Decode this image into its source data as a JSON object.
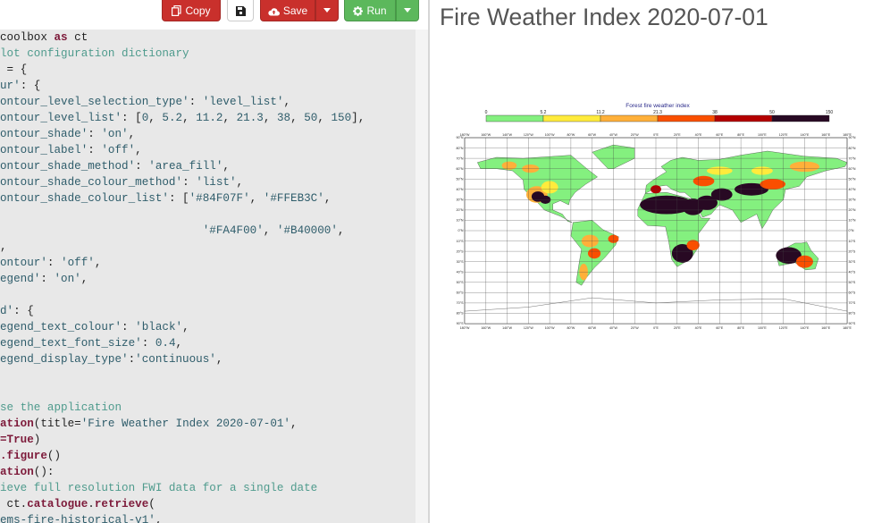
{
  "toolbar": {
    "copy_label": "Copy",
    "save_label": "Save",
    "run_label": "Run"
  },
  "code_lines": [
    [
      [
        "t",
        "coolbox "
      ],
      [
        "k",
        "as"
      ],
      [
        "t",
        " ct"
      ]
    ],
    [
      [
        "c",
        "lot configuration dictionary"
      ]
    ],
    [
      [
        "t",
        " = {"
      ]
    ],
    [
      [
        "s",
        "ur'"
      ],
      [
        "t",
        ": {"
      ]
    ],
    [
      [
        "s",
        "ontour_level_selection_type'"
      ],
      [
        "t",
        ": "
      ],
      [
        "s",
        "'level_list'"
      ],
      [
        "t",
        ","
      ]
    ],
    [
      [
        "s",
        "ontour_level_list'"
      ],
      [
        "t",
        ": ["
      ],
      [
        "n",
        "0"
      ],
      [
        "t",
        ", "
      ],
      [
        "n",
        "5.2"
      ],
      [
        "t",
        ", "
      ],
      [
        "n",
        "11.2"
      ],
      [
        "t",
        ", "
      ],
      [
        "n",
        "21.3"
      ],
      [
        "t",
        ", "
      ],
      [
        "n",
        "38"
      ],
      [
        "t",
        ", "
      ],
      [
        "n",
        "50"
      ],
      [
        "t",
        ", "
      ],
      [
        "n",
        "150"
      ],
      [
        "t",
        "],"
      ]
    ],
    [
      [
        "s",
        "ontour_shade'"
      ],
      [
        "t",
        ": "
      ],
      [
        "s",
        "'on'"
      ],
      [
        "t",
        ","
      ]
    ],
    [
      [
        "s",
        "ontour_label'"
      ],
      [
        "t",
        ": "
      ],
      [
        "s",
        "'off'"
      ],
      [
        "t",
        ","
      ]
    ],
    [
      [
        "s",
        "ontour_shade_method'"
      ],
      [
        "t",
        ": "
      ],
      [
        "s",
        "'area_fill'"
      ],
      [
        "t",
        ","
      ]
    ],
    [
      [
        "s",
        "ontour_shade_colour_method'"
      ],
      [
        "t",
        ": "
      ],
      [
        "s",
        "'list'"
      ],
      [
        "t",
        ","
      ]
    ],
    [
      [
        "s",
        "ontour_shade_colour_list'"
      ],
      [
        "t",
        ": ["
      ],
      [
        "s",
        "'#84F07F'"
      ],
      [
        "t",
        ", "
      ],
      [
        "s",
        "'#FFEB3C'"
      ],
      [
        "t",
        ","
      ]
    ],
    [
      [
        "t",
        ""
      ]
    ],
    [
      [
        "t",
        "                              "
      ],
      [
        "s",
        "'#FA4F00'"
      ],
      [
        "t",
        ", "
      ],
      [
        "s",
        "'#B40000'"
      ],
      [
        "t",
        ","
      ]
    ],
    [
      [
        "t",
        ","
      ]
    ],
    [
      [
        "s",
        "ontour'"
      ],
      [
        "t",
        ": "
      ],
      [
        "s",
        "'off'"
      ],
      [
        "t",
        ","
      ]
    ],
    [
      [
        "s",
        "egend'"
      ],
      [
        "t",
        ": "
      ],
      [
        "s",
        "'on'"
      ],
      [
        "t",
        ","
      ]
    ],
    [
      [
        "t",
        ""
      ]
    ],
    [
      [
        "s",
        "d'"
      ],
      [
        "t",
        ": {"
      ]
    ],
    [
      [
        "s",
        "egend_text_colour'"
      ],
      [
        "t",
        ": "
      ],
      [
        "s",
        "'black'"
      ],
      [
        "t",
        ","
      ]
    ],
    [
      [
        "s",
        "egend_text_font_size'"
      ],
      [
        "t",
        ": "
      ],
      [
        "n",
        "0.4"
      ],
      [
        "t",
        ","
      ]
    ],
    [
      [
        "s",
        "egend_display_type'"
      ],
      [
        "t",
        ":"
      ],
      [
        "s",
        "'continuous'"
      ],
      [
        "t",
        ","
      ]
    ],
    [
      [
        "t",
        ""
      ]
    ],
    [
      [
        "t",
        ""
      ]
    ],
    [
      [
        "c",
        "se the application"
      ]
    ],
    [
      [
        "f",
        "ation"
      ],
      [
        "t",
        "(title="
      ],
      [
        "s",
        "'Fire Weather Index 2020-07-01'"
      ],
      [
        "t",
        ","
      ]
    ],
    [
      [
        "k",
        "=True"
      ],
      [
        "t",
        ")"
      ]
    ],
    [
      [
        "f",
        ".figure"
      ],
      [
        "t",
        "()"
      ]
    ],
    [
      [
        "f",
        "ation"
      ],
      [
        "t",
        "():"
      ]
    ],
    [
      [
        "c",
        "ieve full resolution FWI data for a single date"
      ]
    ],
    [
      [
        "t",
        " ct."
      ],
      [
        "f",
        "catalogue"
      ],
      [
        "t",
        "."
      ],
      [
        "f",
        "retrieve"
      ],
      [
        "t",
        "("
      ]
    ],
    [
      [
        "s",
        "ems-fire-historical-v1'"
      ],
      [
        "t",
        ","
      ]
    ]
  ],
  "output": {
    "title": "Fire Weather Index 2020-07-01"
  },
  "legend": {
    "title": "Forest fire weather index",
    "levels": [
      "0",
      "5.2",
      "11.2",
      "21.3",
      "38",
      "50",
      "150"
    ],
    "colors": [
      "#84F07F",
      "#FFEB3C",
      "#FFB03A",
      "#FA4F00",
      "#B40000",
      "#280923"
    ]
  },
  "map_axes": {
    "lon_labels": [
      "180°W",
      "160°W",
      "140°W",
      "120°W",
      "100°W",
      "80°W",
      "60°W",
      "40°W",
      "20°W",
      "0°E",
      "20°E",
      "40°E",
      "60°E",
      "80°E",
      "100°E",
      "120°E",
      "140°E",
      "160°E",
      "180°E"
    ],
    "lat_labels": [
      "90°N",
      "80°N",
      "70°N",
      "60°N",
      "50°N",
      "40°N",
      "30°N",
      "20°N",
      "10°N",
      "0°N",
      "10°S",
      "20°S",
      "30°S",
      "40°S",
      "50°S",
      "60°S",
      "70°S",
      "80°S",
      "90°S"
    ]
  },
  "colors": {
    "string": "#2f5d6b",
    "comment": "#4f9b8d",
    "keyword": "#7d1a3a",
    "save_button": "#c9302c",
    "run_button": "#5cb85c"
  },
  "icons": {
    "copy": "copy-icon",
    "save_file": "floppy-disk-icon",
    "save": "cloud-upload-icon",
    "run": "gear-icon"
  }
}
